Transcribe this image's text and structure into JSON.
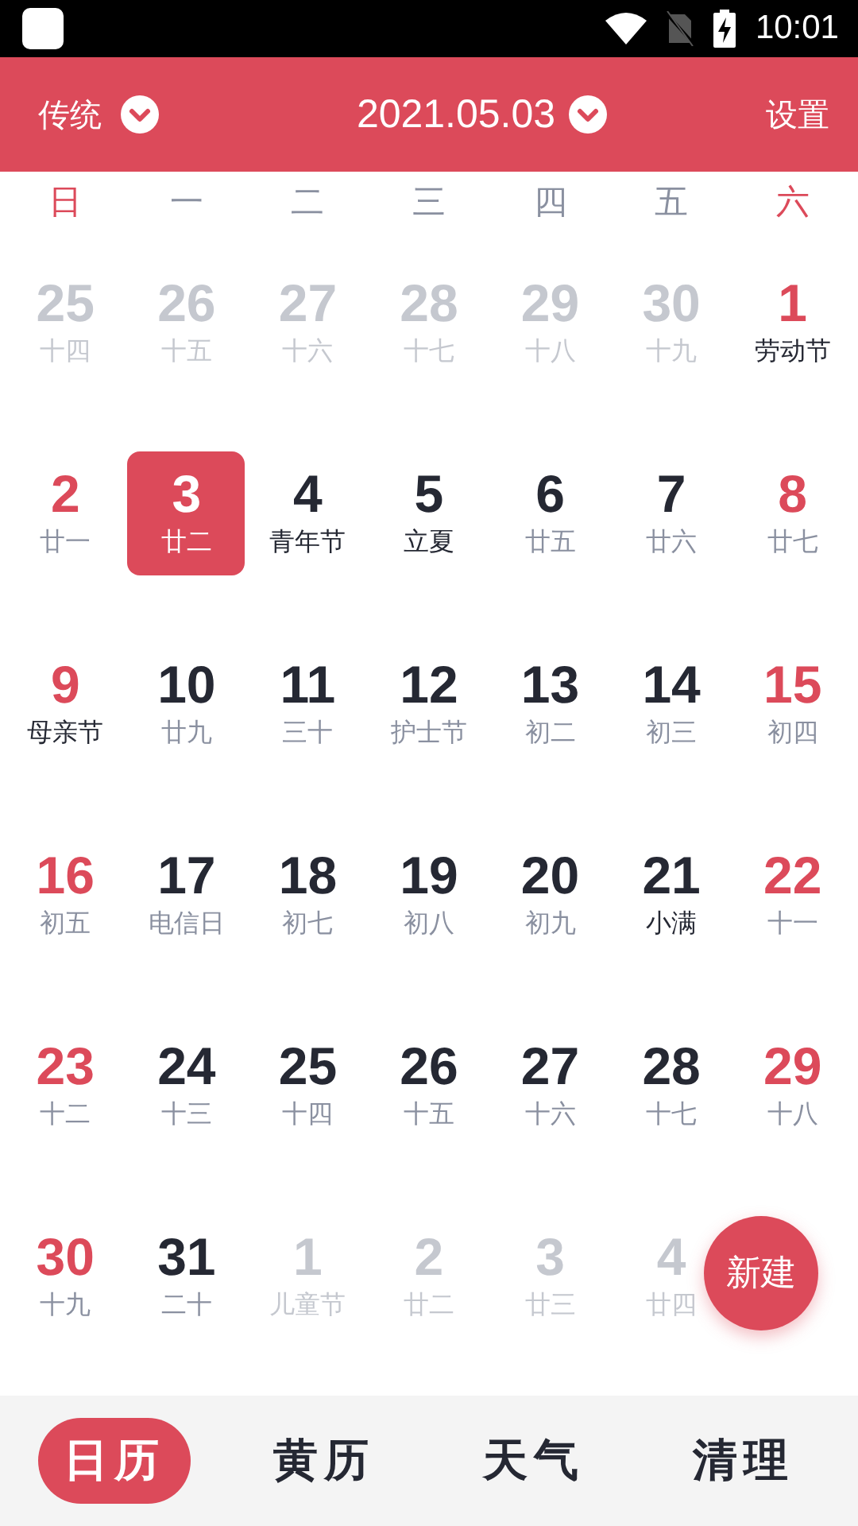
{
  "status_bar": {
    "time": "10:01"
  },
  "header": {
    "mode": "传统",
    "date": "2021.05.03",
    "settings": "设置"
  },
  "weekdays": [
    {
      "label": "日",
      "weekend": true
    },
    {
      "label": "一",
      "weekend": false
    },
    {
      "label": "二",
      "weekend": false
    },
    {
      "label": "三",
      "weekend": false
    },
    {
      "label": "四",
      "weekend": false
    },
    {
      "label": "五",
      "weekend": false
    },
    {
      "label": "六",
      "weekend": true
    }
  ],
  "weeks": [
    [
      {
        "day": "25",
        "lunar": "十四",
        "muted": true,
        "weekend": false,
        "festival": false,
        "selected": false
      },
      {
        "day": "26",
        "lunar": "十五",
        "muted": true,
        "weekend": false,
        "festival": false,
        "selected": false
      },
      {
        "day": "27",
        "lunar": "十六",
        "muted": true,
        "weekend": false,
        "festival": false,
        "selected": false
      },
      {
        "day": "28",
        "lunar": "十七",
        "muted": true,
        "weekend": false,
        "festival": false,
        "selected": false
      },
      {
        "day": "29",
        "lunar": "十八",
        "muted": true,
        "weekend": false,
        "festival": false,
        "selected": false
      },
      {
        "day": "30",
        "lunar": "十九",
        "muted": true,
        "weekend": false,
        "festival": false,
        "selected": false
      },
      {
        "day": "1",
        "lunar": "劳动节",
        "muted": false,
        "weekend": true,
        "festival": true,
        "selected": false
      }
    ],
    [
      {
        "day": "2",
        "lunar": "廿一",
        "muted": false,
        "weekend": true,
        "festival": false,
        "selected": false
      },
      {
        "day": "3",
        "lunar": "廿二",
        "muted": false,
        "weekend": false,
        "festival": false,
        "selected": true
      },
      {
        "day": "4",
        "lunar": "青年节",
        "muted": false,
        "weekend": false,
        "festival": true,
        "selected": false
      },
      {
        "day": "5",
        "lunar": "立夏",
        "muted": false,
        "weekend": false,
        "festival": true,
        "selected": false
      },
      {
        "day": "6",
        "lunar": "廿五",
        "muted": false,
        "weekend": false,
        "festival": false,
        "selected": false
      },
      {
        "day": "7",
        "lunar": "廿六",
        "muted": false,
        "weekend": false,
        "festival": false,
        "selected": false
      },
      {
        "day": "8",
        "lunar": "廿七",
        "muted": false,
        "weekend": true,
        "festival": false,
        "selected": false
      }
    ],
    [
      {
        "day": "9",
        "lunar": "母亲节",
        "muted": false,
        "weekend": true,
        "festival": true,
        "selected": false
      },
      {
        "day": "10",
        "lunar": "廿九",
        "muted": false,
        "weekend": false,
        "festival": false,
        "selected": false
      },
      {
        "day": "11",
        "lunar": "三十",
        "muted": false,
        "weekend": false,
        "festival": false,
        "selected": false
      },
      {
        "day": "12",
        "lunar": "护士节",
        "muted": false,
        "weekend": false,
        "festival": false,
        "selected": false
      },
      {
        "day": "13",
        "lunar": "初二",
        "muted": false,
        "weekend": false,
        "festival": false,
        "selected": false
      },
      {
        "day": "14",
        "lunar": "初三",
        "muted": false,
        "weekend": false,
        "festival": false,
        "selected": false
      },
      {
        "day": "15",
        "lunar": "初四",
        "muted": false,
        "weekend": true,
        "festival": false,
        "selected": false
      }
    ],
    [
      {
        "day": "16",
        "lunar": "初五",
        "muted": false,
        "weekend": true,
        "festival": false,
        "selected": false
      },
      {
        "day": "17",
        "lunar": "电信日",
        "muted": false,
        "weekend": false,
        "festival": false,
        "selected": false
      },
      {
        "day": "18",
        "lunar": "初七",
        "muted": false,
        "weekend": false,
        "festival": false,
        "selected": false
      },
      {
        "day": "19",
        "lunar": "初八",
        "muted": false,
        "weekend": false,
        "festival": false,
        "selected": false
      },
      {
        "day": "20",
        "lunar": "初九",
        "muted": false,
        "weekend": false,
        "festival": false,
        "selected": false
      },
      {
        "day": "21",
        "lunar": "小满",
        "muted": false,
        "weekend": false,
        "festival": true,
        "selected": false
      },
      {
        "day": "22",
        "lunar": "十一",
        "muted": false,
        "weekend": true,
        "festival": false,
        "selected": false
      }
    ],
    [
      {
        "day": "23",
        "lunar": "十二",
        "muted": false,
        "weekend": true,
        "festival": false,
        "selected": false
      },
      {
        "day": "24",
        "lunar": "十三",
        "muted": false,
        "weekend": false,
        "festival": false,
        "selected": false
      },
      {
        "day": "25",
        "lunar": "十四",
        "muted": false,
        "weekend": false,
        "festival": false,
        "selected": false
      },
      {
        "day": "26",
        "lunar": "十五",
        "muted": false,
        "weekend": false,
        "festival": false,
        "selected": false
      },
      {
        "day": "27",
        "lunar": "十六",
        "muted": false,
        "weekend": false,
        "festival": false,
        "selected": false
      },
      {
        "day": "28",
        "lunar": "十七",
        "muted": false,
        "weekend": false,
        "festival": false,
        "selected": false
      },
      {
        "day": "29",
        "lunar": "十八",
        "muted": false,
        "weekend": true,
        "festival": false,
        "selected": false
      }
    ],
    [
      {
        "day": "30",
        "lunar": "十九",
        "muted": false,
        "weekend": true,
        "festival": false,
        "selected": false
      },
      {
        "day": "31",
        "lunar": "二十",
        "muted": false,
        "weekend": false,
        "festival": false,
        "selected": false
      },
      {
        "day": "1",
        "lunar": "儿童节",
        "muted": true,
        "weekend": false,
        "festival": false,
        "selected": false
      },
      {
        "day": "2",
        "lunar": "廿二",
        "muted": true,
        "weekend": false,
        "festival": false,
        "selected": false
      },
      {
        "day": "3",
        "lunar": "廿三",
        "muted": true,
        "weekend": false,
        "festival": false,
        "selected": false
      },
      {
        "day": "4",
        "lunar": "廿四",
        "muted": true,
        "weekend": false,
        "festival": false,
        "selected": false
      }
    ]
  ],
  "fab": {
    "label": "新建"
  },
  "tabs": [
    {
      "label": "日历",
      "selected": true
    },
    {
      "label": "黄历",
      "selected": false
    },
    {
      "label": "天气",
      "selected": false
    },
    {
      "label": "清理",
      "selected": false
    }
  ]
}
